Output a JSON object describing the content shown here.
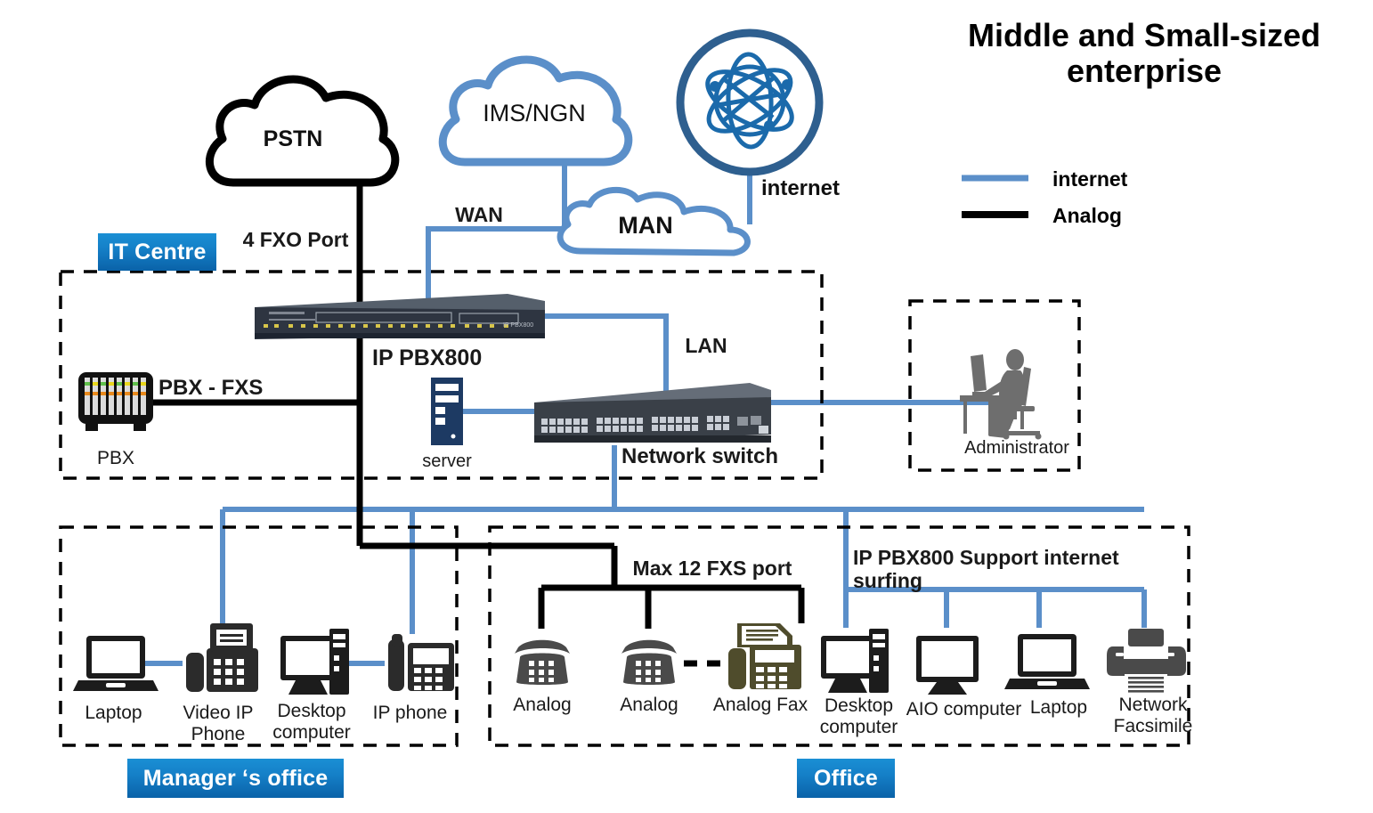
{
  "title": {
    "line1": "Middle and Small-sized",
    "line2": "enterprise"
  },
  "legend": {
    "items": [
      {
        "label": "internet",
        "color": "#5b8fc9",
        "style": "solid-blue"
      },
      {
        "label": "Analog",
        "color": "#000000",
        "style": "solid-black"
      }
    ]
  },
  "clouds": {
    "pstn": {
      "label": "PSTN",
      "color": "#000000"
    },
    "ims": {
      "label": "IMS/NGN",
      "color": "#5b8fc9"
    },
    "man": {
      "label": "MAN",
      "color": "#5b8fc9"
    },
    "internet": {
      "label": "internet",
      "ring_color": "#2e5f8f",
      "icon": "atom-network-icon"
    }
  },
  "link_labels": {
    "fxo": "4 FXO Port",
    "wan": "WAN",
    "lan": "LAN",
    "pbx_fxs": "PBX -  FXS",
    "max_fxs": "Max 12 FXS port",
    "surfing": "IP PBX800 Support internet surfing"
  },
  "zones": {
    "it_centre": {
      "badge": "IT Centre"
    },
    "manager_office": {
      "badge": "Manager ‘s office"
    },
    "office": {
      "badge": "Office"
    },
    "administrator": {
      "label": "Administrator"
    }
  },
  "devices": {
    "ip_pbx": {
      "label": "IP PBX800",
      "face_text": "IP PBX800"
    },
    "pbx": {
      "label": "PBX"
    },
    "server": {
      "label": "server"
    },
    "switch": {
      "label": "Network switch"
    }
  },
  "manager_devices": [
    {
      "label": "Laptop",
      "icon": "laptop-icon"
    },
    {
      "label": "Video IP Phone",
      "icon": "fax-phone-icon"
    },
    {
      "label": "Desktop\ncomputer",
      "icon": "desktop-computer-icon"
    },
    {
      "label": "IP phone",
      "icon": "ip-phone-icon"
    }
  ],
  "office_devices": [
    {
      "label": "Analog",
      "icon": "analog-phone-icon"
    },
    {
      "label": "Analog",
      "icon": "analog-phone-icon"
    },
    {
      "label": "Analog Fax",
      "icon": "analog-fax-icon"
    },
    {
      "label": "Desktop\ncomputer",
      "icon": "desktop-computer-icon"
    },
    {
      "label": "AIO computer",
      "icon": "aio-computer-icon"
    },
    {
      "label": "Laptop",
      "icon": "laptop-icon"
    },
    {
      "label": "Network\nFacsimile",
      "icon": "network-printer-icon"
    }
  ],
  "colors": {
    "internet_line": "#5b8fc9",
    "analog_line": "#000000",
    "badge_blue": "#1580c8",
    "device_dark": "#1c1c1c",
    "fax_olive": "#4f4c2c",
    "server_navy": "#1d3a63",
    "silhouette_gray": "#6e6e6e"
  }
}
